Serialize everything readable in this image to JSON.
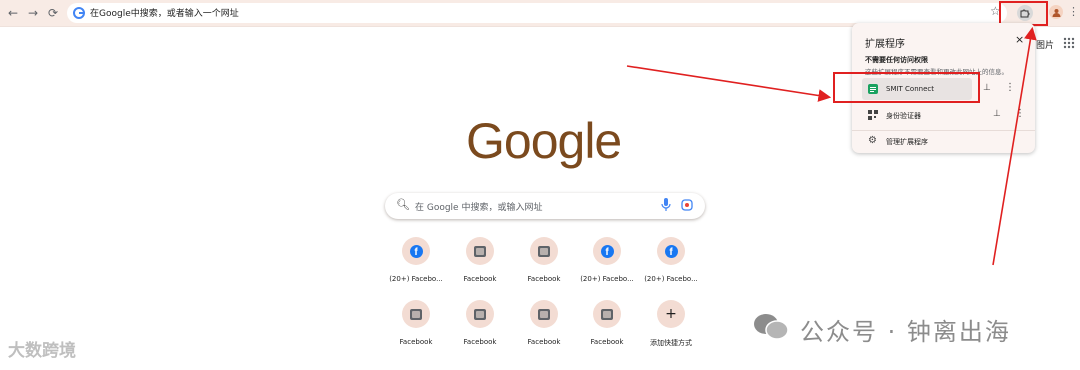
{
  "browser": {
    "omnibox_text": "在Google中搜索，或者输入一个网址",
    "images_link": "图片"
  },
  "extensions_popup": {
    "title": "扩展程序",
    "close": "×",
    "section_title": "不需要任何访问权限",
    "section_desc": "这些扩展程序不需要查看和更改此网站上的信息。",
    "items": [
      {
        "name": "SMIT Connect",
        "icon": "smit-connect-icon"
      },
      {
        "name": "身份验证器",
        "icon": "qr-authenticator-icon"
      }
    ],
    "manage_label": "管理扩展程序"
  },
  "ntp": {
    "logo": "Google",
    "search_placeholder": "在 Google 中搜索，或输入网址",
    "shortcuts": [
      {
        "label": "(20+) Facebo...",
        "icon": "facebook-icon"
      },
      {
        "label": "Facebook",
        "icon": "image-icon"
      },
      {
        "label": "Facebook",
        "icon": "image-icon"
      },
      {
        "label": "(20+) Facebo...",
        "icon": "facebook-icon"
      },
      {
        "label": "(20+) Facebo...",
        "icon": "facebook-icon"
      },
      {
        "label": "Facebook",
        "icon": "image-icon"
      },
      {
        "label": "Facebook",
        "icon": "image-icon"
      },
      {
        "label": "Facebook",
        "icon": "image-icon"
      },
      {
        "label": "Facebook",
        "icon": "image-icon"
      },
      {
        "label": "添加快捷方式",
        "icon": "add-icon"
      }
    ]
  },
  "watermarks": {
    "left": "大数跨境",
    "right": "公众号 · 钟离出海"
  },
  "colors": {
    "annotation_red": "#e02020",
    "toolbar_bg": "#f8ebe5",
    "logo_brown": "#7b4a1e"
  }
}
